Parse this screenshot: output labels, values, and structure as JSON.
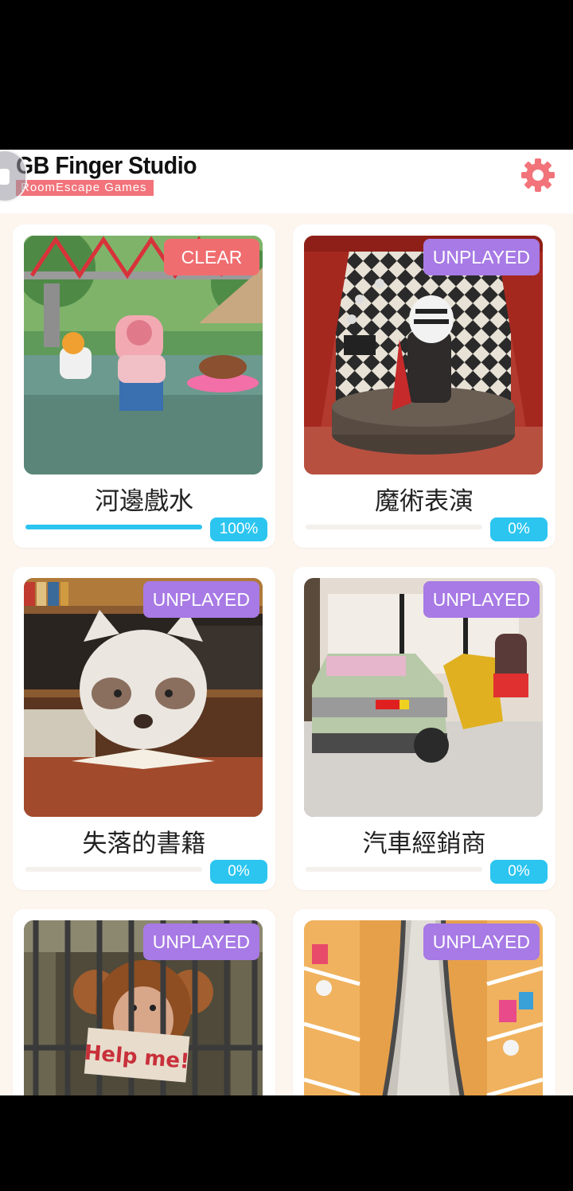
{
  "header": {
    "studio_name": "GB Finger Studio",
    "subtitle": "RoomEscape  Games",
    "settings_icon": "gear-icon",
    "accent_color": "#f2737a"
  },
  "games": [
    {
      "title": "河邊戲水",
      "status": "CLEAR",
      "progress_label": "100%",
      "progress": 1.0,
      "scene": "river-pig"
    },
    {
      "title": "魔術表演",
      "status": "UNPLAYED",
      "progress_label": "0%",
      "progress": 0.0,
      "scene": "magic-zebra"
    },
    {
      "title": "失落的書籍",
      "status": "UNPLAYED",
      "progress_label": "0%",
      "progress": 0.0,
      "scene": "library-raccoon"
    },
    {
      "title": "汽車經銷商",
      "status": "UNPLAYED",
      "progress_label": "0%",
      "progress": 0.0,
      "scene": "car-dealer"
    },
    {
      "title": "",
      "status": "UNPLAYED",
      "progress_label": "",
      "progress": 0.0,
      "scene": "jail-monkey",
      "sign_text": "Help me!"
    },
    {
      "title": "",
      "status": "UNPLAYED",
      "progress_label": "",
      "progress": 0.0,
      "scene": "mall-escalator"
    }
  ],
  "colors": {
    "clear_badge": "#f06d6f",
    "unplayed_badge": "#a77ae5",
    "progress": "#2bc5f0",
    "background": "#fdf6ef"
  }
}
